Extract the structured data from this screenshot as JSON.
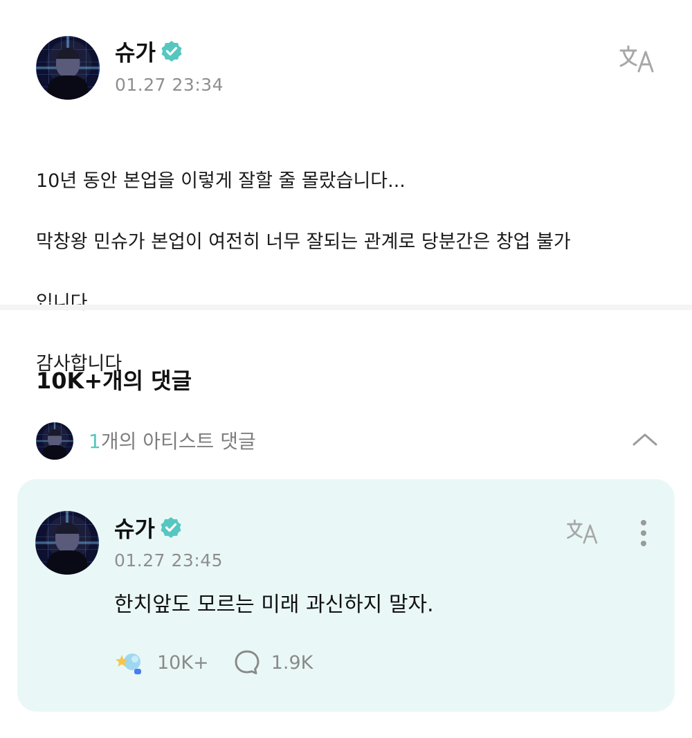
{
  "post": {
    "author": "슈가",
    "timestamp": "01.27 23:34",
    "lines": [
      "10년 동안 본업을 이렇게 잘할 줄 몰랐습니다...",
      "막창왕 민슈가 본업이 여전히 너무 잘되는 관계로 당분간은 창업 불가",
      "입니다",
      "감사합니다"
    ]
  },
  "comments": {
    "title": "10K+개의 댓글",
    "artist_row": {
      "count": "1",
      "label": "개의 아티스트 댓글"
    }
  },
  "artist_comment": {
    "author": "슈가",
    "timestamp": "01.27 23:45",
    "text": "한치앞도 모르는 미래 과신하지 말자.",
    "likes": "10K+",
    "replies": "1.9K"
  },
  "icons": {
    "verified": "verified-badge-icon",
    "translate": "translate-icon",
    "chevron": "chevron-up-icon",
    "more": "more-vertical-icon",
    "like": "like-star-icon",
    "comment": "comment-bubble-icon"
  },
  "colors": {
    "accent": "#56c7c0",
    "card_bg": "#e9f8f6",
    "muted": "#8e8e8e"
  }
}
